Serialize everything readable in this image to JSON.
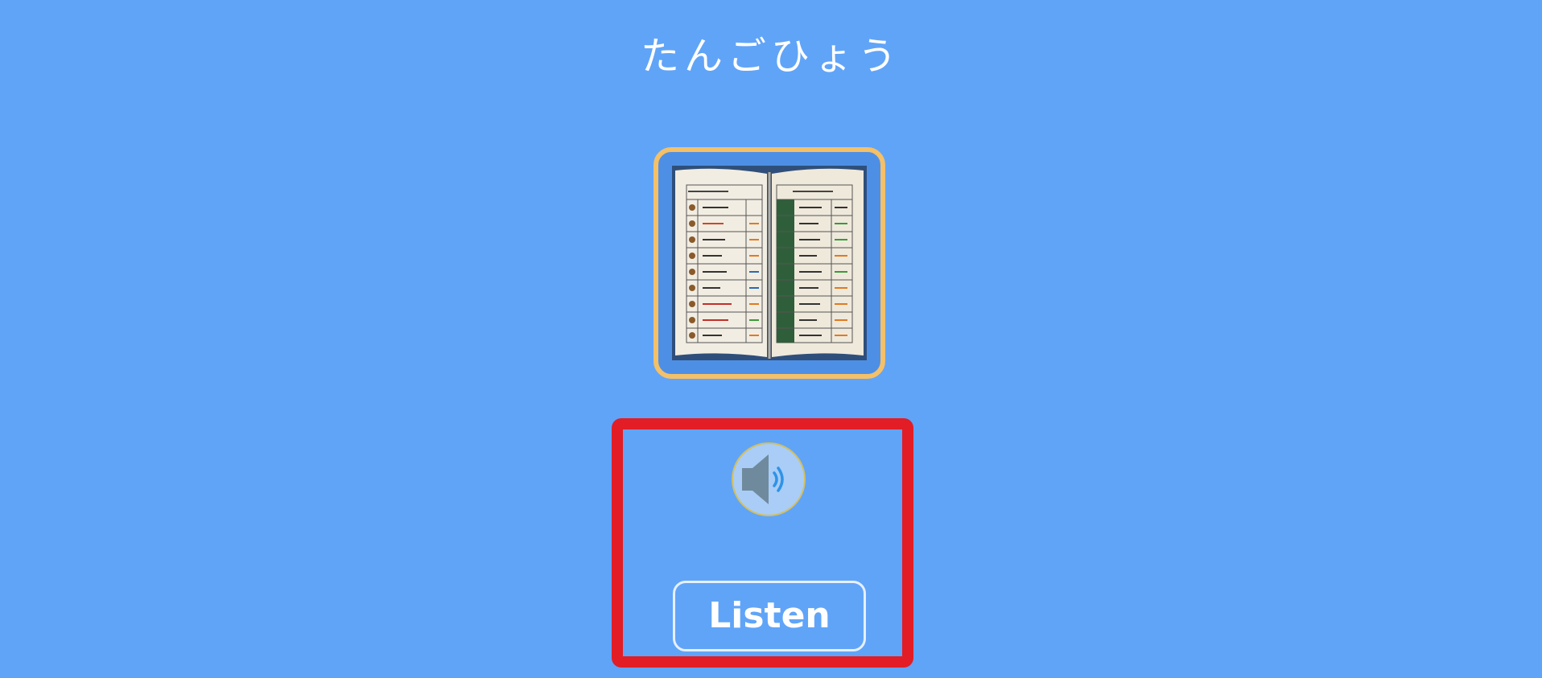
{
  "page": {
    "title": "たんごひょう"
  },
  "flashcard": {
    "image_icon": "open-notebook-vocabulary-table-image",
    "frame_color": "#f4c068"
  },
  "audio": {
    "speaker_icon": "speaker-icon",
    "listen_label": "Listen"
  },
  "annotation": {
    "highlight_color": "#e21d25"
  }
}
